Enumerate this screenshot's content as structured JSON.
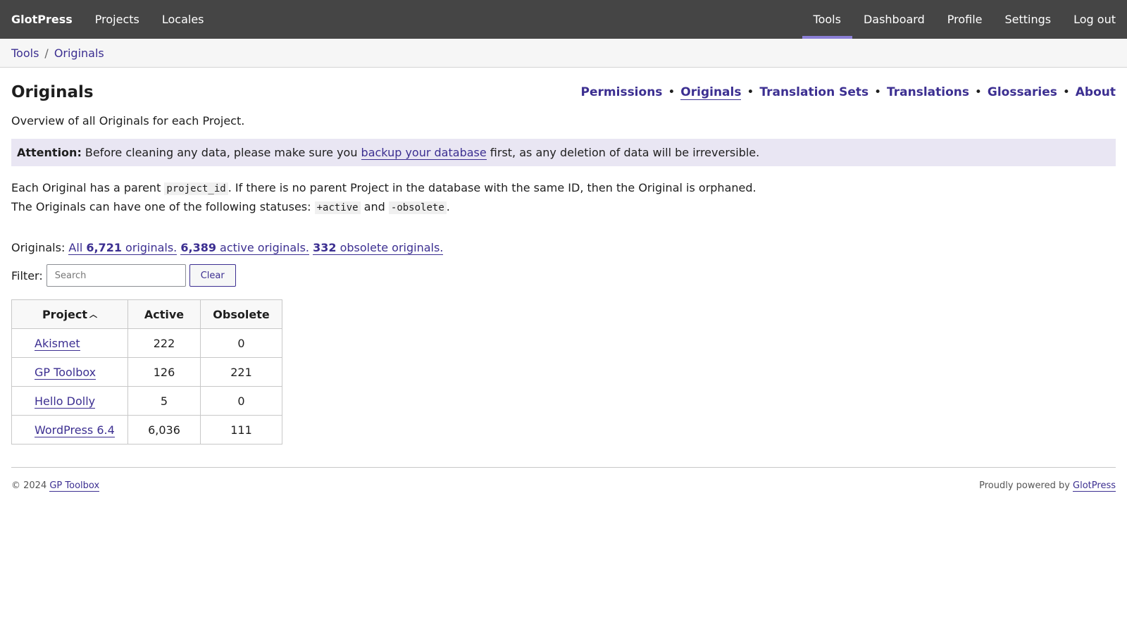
{
  "topbar": {
    "brand": "GlotPress",
    "left_nav": [
      "Projects",
      "Locales"
    ],
    "right_nav": [
      "Tools",
      "Dashboard",
      "Profile",
      "Settings",
      "Log out"
    ],
    "active": "Tools",
    "active_color": "#8b7fd6",
    "bg_color": "#454545"
  },
  "breadcrumb": {
    "root": "Tools",
    "sep": "/",
    "current": "Originals"
  },
  "page": {
    "title": "Originals",
    "tabs": [
      "Permissions",
      "Originals",
      "Translation Sets",
      "Translations",
      "Glossaries",
      "About"
    ],
    "tab_sep": "•",
    "current_tab": "Originals",
    "description": "Overview of all Originals for each Project."
  },
  "notice": {
    "label": "Attention:",
    "before": " Before cleaning any data, please make sure you ",
    "link": "backup your database",
    "after": " first, as any deletion of data will be irreversible."
  },
  "info": {
    "line1_a": "Each Original has a parent ",
    "line1_code": "project_id",
    "line1_b": ". If there is no parent Project in the database with the same ID, then the Original is orphaned.",
    "line2_a": "The Originals can have one of the following statuses: ",
    "status_active": "+active",
    "line2_and": " and ",
    "status_obsolete": "-obsolete",
    "line2_end": "."
  },
  "counts": {
    "label": "Originals: ",
    "all_pre": "All ",
    "all_num": "6,721",
    "all_post": " originals.",
    "active_num": "6,389",
    "active_post": " active originals.",
    "obsolete_num": "332",
    "obsolete_post": " obsolete originals."
  },
  "filter": {
    "label": "Filter:",
    "placeholder": "Search",
    "clear": "Clear"
  },
  "table": {
    "headers": {
      "project": "Project",
      "active": "Active",
      "obsolete": "Obsolete"
    },
    "sort_icon": "chevron-up-icon",
    "rows": [
      {
        "project": "Akismet",
        "active": "222",
        "obsolete": "0"
      },
      {
        "project": "GP Toolbox",
        "active": "126",
        "obsolete": "221"
      },
      {
        "project": "Hello Dolly",
        "active": "5",
        "obsolete": "0"
      },
      {
        "project": "WordPress 6.4",
        "active": "6,036",
        "obsolete": "111"
      }
    ]
  },
  "footer": {
    "copyright": "© 2024 ",
    "copyright_link": "GP Toolbox",
    "powered": "Proudly powered by ",
    "powered_link": "GlotPress"
  },
  "colors": {
    "link": "#3c2f91",
    "notice_bg": "#e9e6f3"
  }
}
